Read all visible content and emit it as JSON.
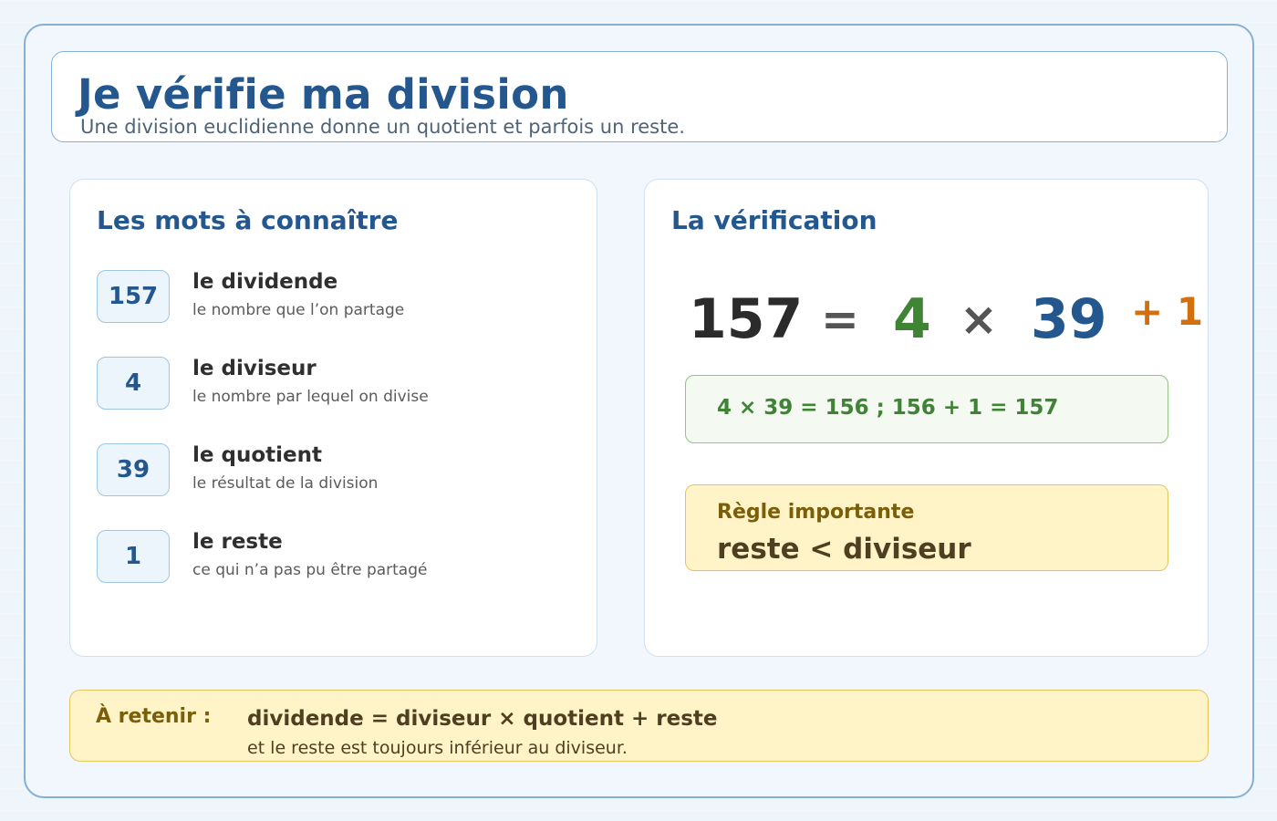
{
  "header": {
    "title": "Je vérifie ma division",
    "subtitle": "Une division euclidienne donne un quotient et parfois un reste."
  },
  "words": {
    "title": "Les mots à connaître",
    "items": [
      {
        "value": "157",
        "name": "le dividende",
        "desc": "le nombre que l’on partage"
      },
      {
        "value": "4",
        "name": "le diviseur",
        "desc": "le nombre par lequel on divise"
      },
      {
        "value": "39",
        "name": "le quotient",
        "desc": "le résultat de la division"
      },
      {
        "value": "1",
        "name": "le reste",
        "desc": "ce qui n’a pas pu être partagé"
      }
    ]
  },
  "verification": {
    "title": "La vérification",
    "equation": {
      "dividend": "157",
      "equals": "=",
      "divisor": "4",
      "times": "×",
      "quotient": "39",
      "remainder": "+ 1"
    },
    "check": "4 × 39 = 156 ; 156 + 1 = 157",
    "rule_title": "Règle importante",
    "rule_text": "reste < diviseur"
  },
  "summary": {
    "label": "À retenir :",
    "formula": "dividende = diviseur × quotient + reste",
    "note": "et le reste est toujours inférieur au diviseur."
  },
  "colors": {
    "title_blue": "#24578e",
    "divisor_green": "#3e8434",
    "remainder_orange": "#d2700f",
    "rule_yellow": "#fff3c8"
  }
}
